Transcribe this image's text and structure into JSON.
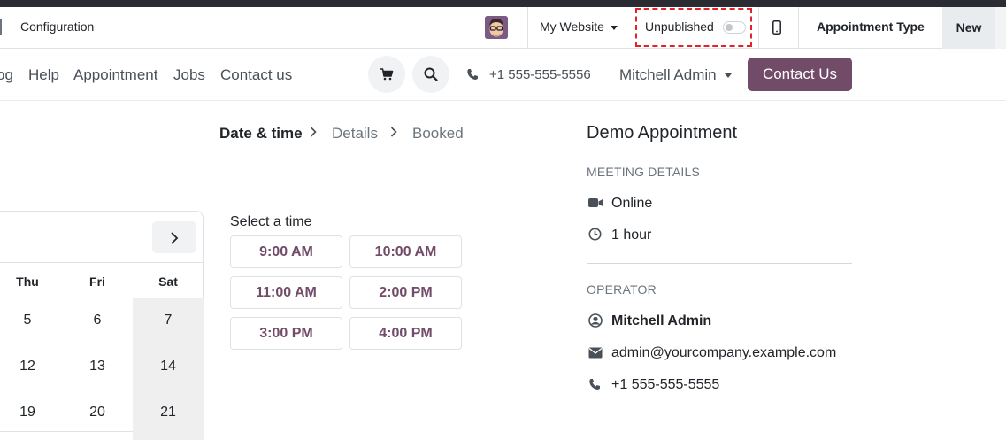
{
  "admin_bar": {
    "configuration_label": "Configuration",
    "website_label": "My Website",
    "publish_label": "Unpublished",
    "record_type_label": "Appointment Type",
    "new_label": "New"
  },
  "nav": {
    "links": [
      "og",
      "Help",
      "Appointment",
      "Jobs",
      "Contact us"
    ],
    "phone": "+1 555-555-5556",
    "user": "Mitchell Admin",
    "cta": "Contact Us",
    "brand_color": "#714b67"
  },
  "breadcrumb": {
    "steps": [
      "Date & time",
      "Details",
      "Booked"
    ]
  },
  "calendar": {
    "weekdays": [
      "Thu",
      "Fri",
      "Sat"
    ],
    "rows": [
      [
        "5",
        "6",
        "7"
      ],
      [
        "12",
        "13",
        "14"
      ],
      [
        "19",
        "20",
        "21"
      ]
    ]
  },
  "slots": {
    "label": "Select a time",
    "times": [
      "9:00 AM",
      "10:00 AM",
      "11:00 AM",
      "2:00 PM",
      "3:00 PM",
      "4:00 PM"
    ]
  },
  "details": {
    "title": "Demo Appointment",
    "meeting_heading": "MEETING DETAILS",
    "location": "Online",
    "duration": "1 hour",
    "operator_heading": "OPERATOR",
    "operator_name": "Mitchell Admin",
    "operator_email": "admin@yourcompany.example.com",
    "operator_phone": "+1 555-555-5555"
  }
}
